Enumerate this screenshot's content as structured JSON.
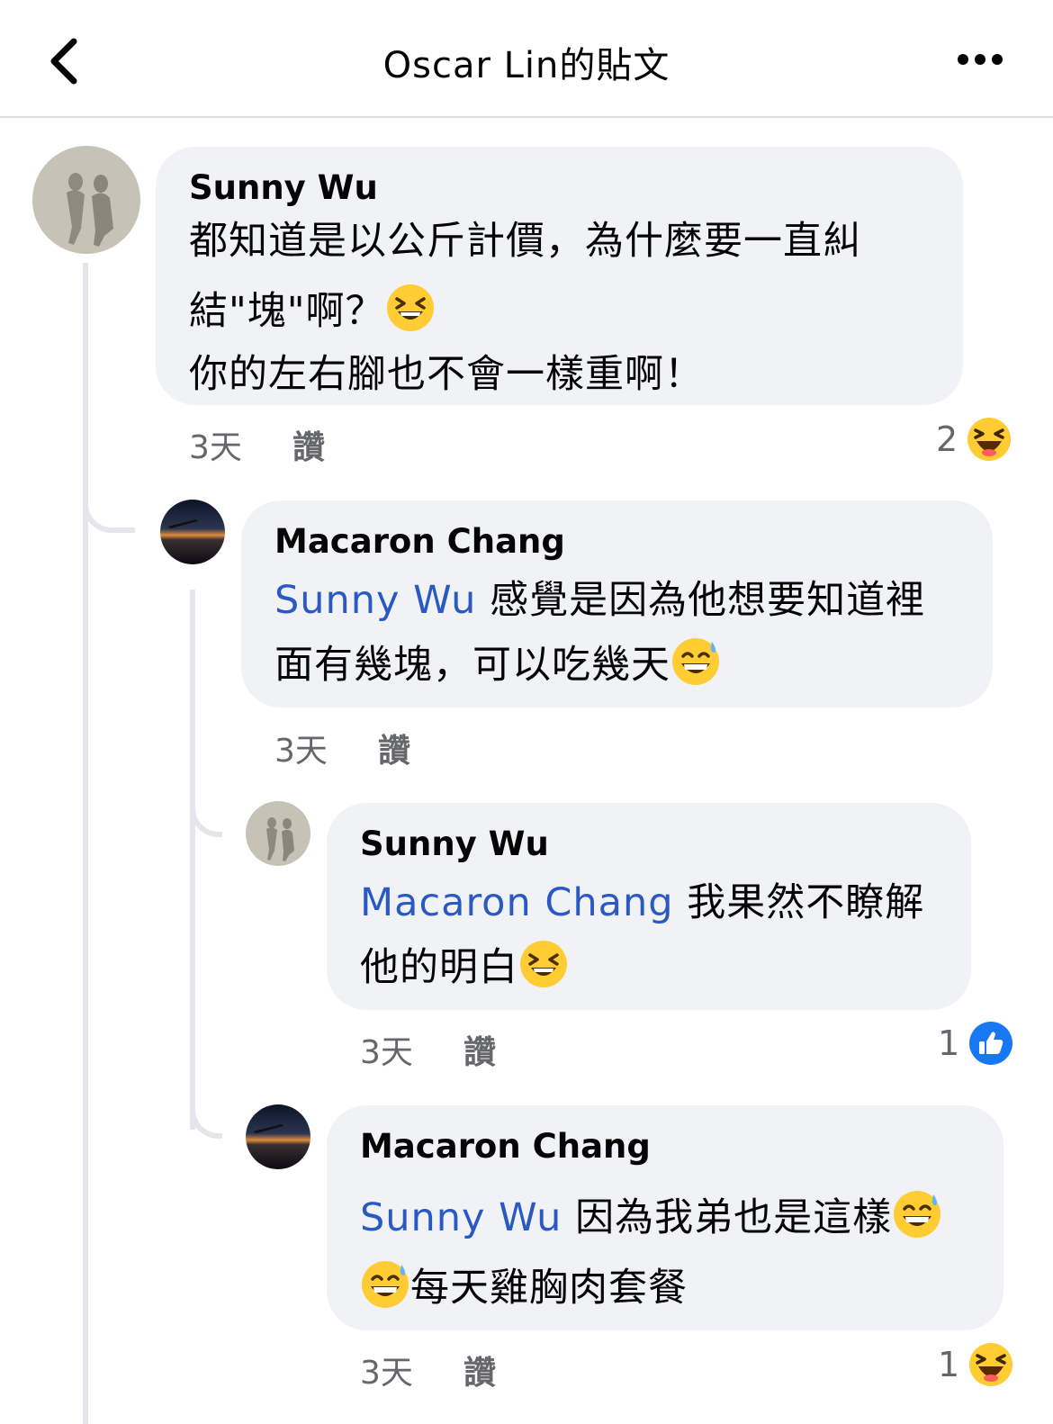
{
  "header": {
    "title": "Oscar Lin的貼文",
    "back_icon": "chevron-left-icon",
    "more_icon": "more-horizontal-icon"
  },
  "colors": {
    "mention": "#2b59c3",
    "bubble": "#f0f2f5",
    "meta": "#65676b",
    "like_blue": "#1877f2"
  },
  "comments": [
    {
      "author": "Sunny Wu",
      "lines": [
        "都知道是以公斤計價，為什麼要一直糾",
        "結\"塊\"啊？",
        "你的左右腳也不會一樣重啊！"
      ],
      "emoji": "laughing-squinting-emoji",
      "time": "3天",
      "like_label": "讚",
      "reaction_count": "2",
      "reaction_icon": "haha-reaction-icon"
    },
    {
      "author": "Macaron Chang",
      "mention": "Sunny Wu",
      "lines": [
        " 感覺是因為他想要知道裡",
        "面有幾塊，可以吃幾天"
      ],
      "emoji": "grinning-sweat-emoji",
      "time": "3天",
      "like_label": "讚"
    },
    {
      "author": "Sunny Wu",
      "mention": "Macaron Chang",
      "lines": [
        " 我果然不瞭解",
        "他的明白"
      ],
      "emoji": "laughing-squinting-emoji",
      "time": "3天",
      "like_label": "讚",
      "reaction_count": "1",
      "reaction_icon": "like-reaction-icon"
    },
    {
      "author": "Macaron Chang",
      "mention": "Sunny Wu",
      "lines": [
        " 因為我弟也是這樣",
        "每天雞胸肉套餐"
      ],
      "emoji": "grinning-sweat-emoji",
      "time": "3天",
      "like_label": "讚",
      "reaction_count": "1",
      "reaction_icon": "haha-reaction-icon"
    }
  ]
}
